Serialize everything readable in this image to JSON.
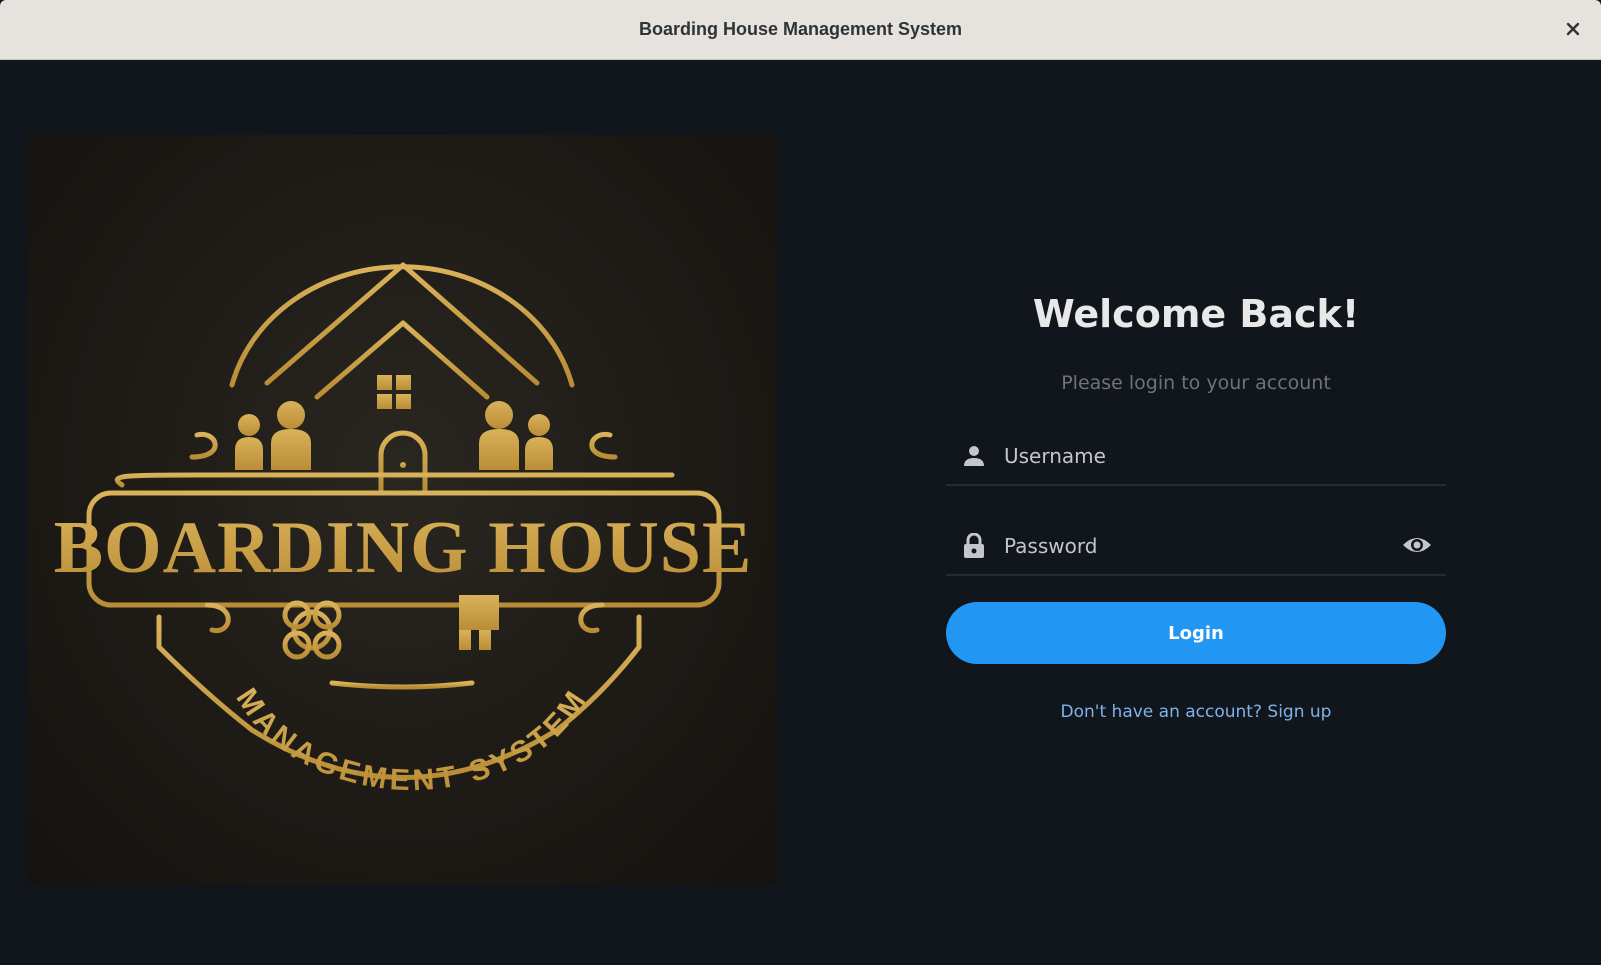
{
  "window": {
    "title": "Boarding House Management System",
    "close_symbol": "✕"
  },
  "logo": {
    "alt_icon": "boarding-house-logo",
    "line1": "BOARDING HOUSE",
    "line2": "MANAGEMENT SYSTEM",
    "colors": {
      "gold": "#c9a045",
      "background": "#1e1b17"
    }
  },
  "login": {
    "heading": "Welcome Back!",
    "subheading": "Please login to your account",
    "username": {
      "placeholder": "Username",
      "value": "",
      "icon": "user-icon"
    },
    "password": {
      "placeholder": "Password",
      "value": "",
      "icon": "lock-icon",
      "toggle_icon": "eye-icon"
    },
    "submit_label": "Login",
    "signup_text": "Don't have an account? Sign up"
  },
  "colors": {
    "accent": "#2196f3",
    "window_bg": "#11151c",
    "link": "#7fb2e8"
  }
}
